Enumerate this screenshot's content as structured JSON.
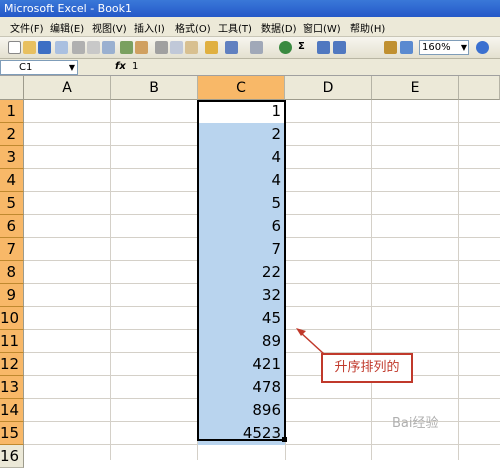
{
  "window": {
    "title": "Microsoft Excel - Book1"
  },
  "menu": [
    "文件(F)",
    "编辑(E)",
    "视图(V)",
    "插入(I)",
    "格式(O)",
    "工具(T)",
    "数据(D)",
    "窗口(W)",
    "帮助(H)"
  ],
  "toolbar": {
    "zoom": "160%",
    "sum_symbol": "Σ"
  },
  "formula_bar": {
    "name_box": "C1",
    "fx": "fx",
    "value": "1"
  },
  "columns": [
    "A",
    "B",
    "C",
    "D",
    "E"
  ],
  "rows": [
    "1",
    "2",
    "3",
    "4",
    "5",
    "6",
    "7",
    "8",
    "9",
    "10",
    "11",
    "12",
    "13",
    "14",
    "15",
    "16"
  ],
  "column_c_values": [
    "1",
    "2",
    "4",
    "4",
    "5",
    "6",
    "7",
    "22",
    "32",
    "45",
    "89",
    "421",
    "478",
    "896",
    "4523"
  ],
  "annotation": {
    "text": "升序排列的"
  },
  "watermark": {
    "text": "Bai经验"
  }
}
